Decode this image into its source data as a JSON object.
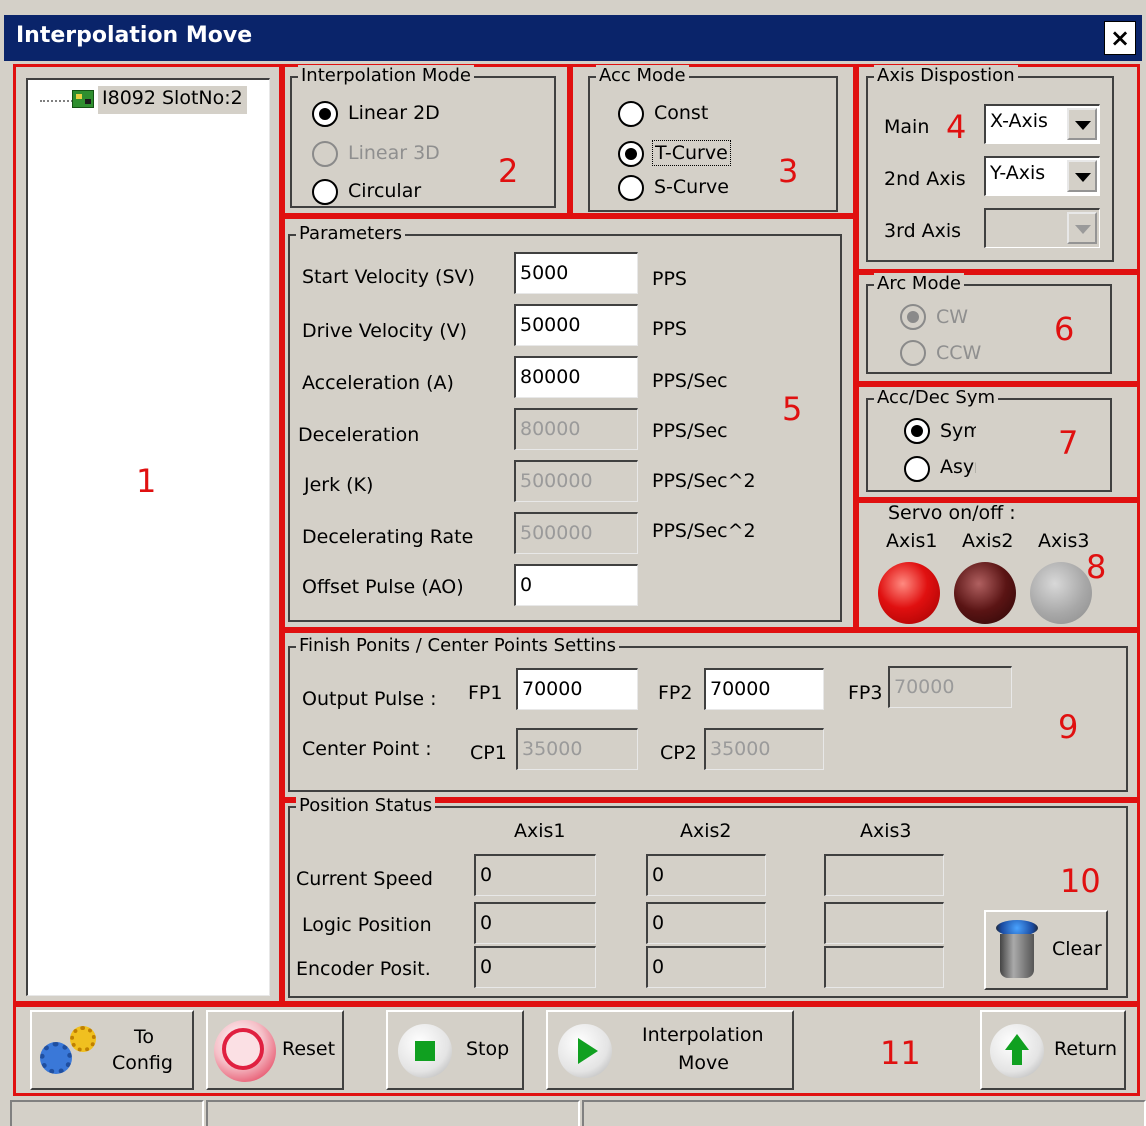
{
  "window": {
    "title": "Interpolation Move",
    "close_label": "×"
  },
  "tree": {
    "node_label": "I8092 SlotNo:2",
    "icon": "pcb-card-icon"
  },
  "interp_mode": {
    "legend": "Interpolation Mode",
    "options": [
      {
        "label": "Linear 2D",
        "checked": true,
        "enabled": true
      },
      {
        "label": "Linear 3D",
        "checked": false,
        "enabled": false
      },
      {
        "label": "Circular",
        "checked": false,
        "enabled": true
      }
    ]
  },
  "acc_mode": {
    "legend": "Acc Mode",
    "options": [
      {
        "label": "Const",
        "checked": false
      },
      {
        "label": "T-Curve",
        "checked": true
      },
      {
        "label": "S-Curve",
        "checked": false
      }
    ]
  },
  "axis_disposition": {
    "legend": "Axis Dispostion",
    "main_label": "Main",
    "main_value": "X-Axis",
    "second_label": "2nd Axis",
    "second_value": "Y-Axis",
    "third_label": "3rd Axis",
    "third_value": ""
  },
  "parameters": {
    "legend": "Parameters",
    "rows": [
      {
        "label": "Start Velocity (SV)",
        "value": "5000",
        "unit": "PPS",
        "enabled": true
      },
      {
        "label": "Drive Velocity (V)",
        "value": "50000",
        "unit": "PPS",
        "enabled": true
      },
      {
        "label": "Acceleration (A)",
        "value": "80000",
        "unit": "PPS/Sec",
        "enabled": true
      },
      {
        "label": "Deceleration",
        "value": "80000",
        "unit": "PPS/Sec",
        "enabled": false
      },
      {
        "label": "Jerk (K)",
        "value": "500000",
        "unit": "PPS/Sec^2",
        "enabled": false
      },
      {
        "label": "Decelerating Rate",
        "value": "500000",
        "unit": "PPS/Sec^2",
        "enabled": false
      },
      {
        "label": "Offset Pulse (AO)",
        "value": "0",
        "unit": "",
        "enabled": true
      }
    ]
  },
  "arc_mode": {
    "legend": "Arc Mode",
    "options": [
      {
        "label": "CW",
        "checked": true
      },
      {
        "label": "CCW",
        "checked": false
      }
    ]
  },
  "acc_dec_sym": {
    "legend": "Acc/Dec Sym",
    "options": [
      {
        "label": "Sym",
        "checked": true
      },
      {
        "label": "Asym",
        "checked": false
      }
    ]
  },
  "servo": {
    "title": "Servo on/off :",
    "axes": [
      {
        "label": "Axis1",
        "color": "#e01010"
      },
      {
        "label": "Axis2",
        "color": "#5a1414"
      },
      {
        "label": "Axis3",
        "color": "#a8a8a8"
      }
    ]
  },
  "finish_points": {
    "legend": "Finish Ponits / Center Points Settins",
    "output_label": "Output Pulse :",
    "fp1_label": "FP1",
    "fp1_value": "70000",
    "fp2_label": "FP2",
    "fp2_value": "70000",
    "fp3_label": "FP3",
    "fp3_value": "70000",
    "center_label": "Center Point :",
    "cp1_label": "CP1",
    "cp1_value": "35000",
    "cp2_label": "CP2",
    "cp2_value": "35000"
  },
  "position_status": {
    "legend": "Position Status",
    "columns": [
      "Axis1",
      "Axis2",
      "Axis3"
    ],
    "rows": [
      {
        "label": "Current Speed",
        "values": [
          "0",
          "0",
          ""
        ]
      },
      {
        "label": "Logic Position",
        "values": [
          "0",
          "0",
          ""
        ]
      },
      {
        "label": "Encoder Posit.",
        "values": [
          "0",
          "0",
          ""
        ]
      }
    ],
    "clear_label": "Clear"
  },
  "toolbar": {
    "to_config_line1": "To",
    "to_config_line2": "Config",
    "reset_label": "Reset",
    "stop_label": "Stop",
    "interp_line1": "Interpolation",
    "interp_line2": "Move",
    "return_label": "Return"
  },
  "annotations": [
    "1",
    "2",
    "3",
    "4",
    "5",
    "6",
    "7",
    "8",
    "9",
    "10",
    "11"
  ],
  "colors": {
    "annotation_red": "#e01010",
    "title_bar": "#0a246a",
    "face": "#d4d0c8"
  }
}
